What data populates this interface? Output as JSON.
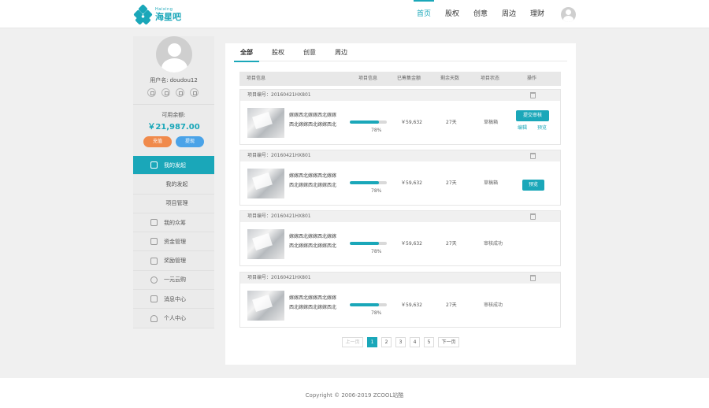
{
  "header": {
    "logo_en": "Haixing",
    "logo_cn": "海星吧",
    "nav": [
      "首页",
      "股权",
      "创意",
      "周边",
      "理财"
    ]
  },
  "sidebar": {
    "username_label": "用户名:",
    "username": "doudou12",
    "balance_label": "可用余额:",
    "balance": "￥21,987.00",
    "charge": "充值",
    "withdraw": "提现",
    "menu": [
      {
        "label": "我的发起",
        "icon": "edit-icon"
      },
      {
        "label": "我的发起"
      },
      {
        "label": "项目管理"
      },
      {
        "label": "我的众筹",
        "icon": "document-icon"
      },
      {
        "label": "资金管理",
        "icon": "wallet-icon"
      },
      {
        "label": "奖励管理",
        "icon": "gift-icon"
      },
      {
        "label": "一元云购",
        "icon": "clock-icon"
      },
      {
        "label": "消息中心",
        "icon": "mail-icon"
      },
      {
        "label": "个人中心",
        "icon": "user-icon"
      }
    ]
  },
  "tabs": [
    "全部",
    "股权",
    "创意",
    "周边"
  ],
  "table_headers": [
    "项目信息",
    "项目信息",
    "已筹集金额",
    "剩余天数",
    "项目状态",
    "操作"
  ],
  "items": [
    {
      "code": "项目编号：20160421HX801",
      "desc1": "嫁嫁西北嫁嫁西北嫁嫁",
      "desc2": "西北嫁嫁西北嫁嫁西北",
      "progress": 78,
      "pct": "78%",
      "amount": "￥59,632",
      "days": "27天",
      "status": "草稿箱",
      "primary_action": "提交审核",
      "edit": "编辑",
      "preview": "预览"
    },
    {
      "code": "项目编号：20160421HX801",
      "desc1": "嫁嫁西北嫁嫁西北嫁嫁",
      "desc2": "西北嫁嫁西北嫁嫁西北",
      "progress": 78,
      "pct": "78%",
      "amount": "￥59,632",
      "days": "27天",
      "status": "草稿箱",
      "preview_btn": "预览"
    },
    {
      "code": "项目编号：20160421HX801",
      "desc1": "嫁嫁西北嫁嫁西北嫁嫁",
      "desc2": "西北嫁嫁西北嫁嫁西北",
      "progress": 78,
      "pct": "78%",
      "amount": "￥59,632",
      "days": "27天",
      "status": "审核成功"
    },
    {
      "code": "项目编号：20160421HX801",
      "desc1": "嫁嫁西北嫁嫁西北嫁嫁",
      "desc2": "西北嫁嫁西北嫁嫁西北",
      "progress": 78,
      "pct": "78%",
      "amount": "￥59,632",
      "days": "27天",
      "status": "审核成功"
    }
  ],
  "pager": {
    "prev": "上一页",
    "pages": [
      "1",
      "2",
      "3",
      "4",
      "5"
    ],
    "next": "下一页"
  },
  "footer": "Copyright © 2006-2019 ZCOOL站酷",
  "colors": {
    "accent": "#1aa7b9",
    "charge": "#f08a4b",
    "withdraw": "#4aa3e8"
  }
}
